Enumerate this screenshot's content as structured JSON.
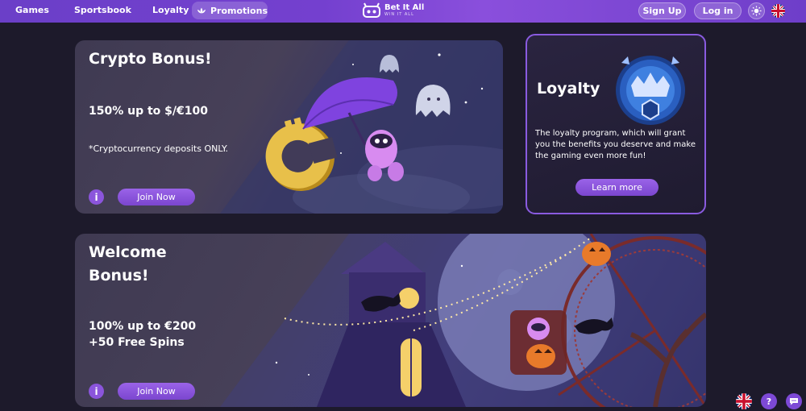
{
  "nav": {
    "games": "Games",
    "sportsbook": "Sportsbook",
    "loyalty": "Loyalty",
    "promotions": "Promotions",
    "logo_title": "Bet It All",
    "logo_tagline": "WIN IT ALL",
    "signup": "Sign Up",
    "login": "Log in"
  },
  "crypto_card": {
    "title": "Crypto Bonus!",
    "offer": "150% up to $/€100",
    "note": "*Cryptocurrency deposits ONLY.",
    "info": "i",
    "cta": "Join Now"
  },
  "loyalty_card": {
    "title": "Loyalty",
    "description": "The loyalty program, which will grant you the benefits you deserve and make the gaming even more fun!",
    "cta": "Learn more"
  },
  "welcome_card": {
    "title_line1": "Welcome",
    "title_line2": "Bonus!",
    "offer_line1": "100% up to €200",
    "offer_line2": "+50 Free Spins",
    "info": "i",
    "cta": "Join Now"
  },
  "floating": {
    "help": "?"
  },
  "colors": {
    "nav_gradient_start": "#6b3fc8",
    "accent": "#8b55dc",
    "page_bg": "#1d1a2b",
    "loyalty_border": "#8a5be0"
  }
}
